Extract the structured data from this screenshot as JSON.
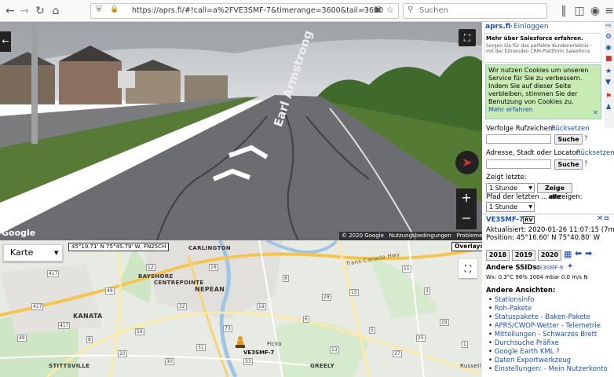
{
  "browser": {
    "url": "https://aprs.fi/#!call=a%2FVE3SMF-7&timerange=3600&tail=3600",
    "search_placeholder": "Suchen"
  },
  "streetview": {
    "street_sign": "Earl Armstrong",
    "google_logo": "Google",
    "copyright": "© 2020 Google",
    "terms": "Nutzungsbedingungen",
    "report": "Probleme melden"
  },
  "map": {
    "type_select": "Karte",
    "coords": "45°19.71' N 75°45.79' W, FN25CH",
    "overlays": "Overlays",
    "station_label": "VE3SMF-7",
    "places": [
      "CARLINGTON",
      "NEPEAN",
      "BAYSHORE",
      "CENTREPOINTE",
      "KANATA",
      "STITTSVILLE",
      "GREELY",
      "Ficko",
      "Russell",
      "Trans-Canada Hwy"
    ],
    "road_numbers": [
      "417",
      "49",
      "12",
      "16",
      "32",
      "19",
      "15",
      "73",
      "59",
      "8",
      "49",
      "417",
      "417",
      "11",
      "3",
      "5",
      "13",
      "19",
      "6",
      "8",
      "27",
      "30",
      "31",
      "33",
      "10",
      "1",
      "25",
      "28"
    ]
  },
  "sidebar": {
    "site": "aprs.fi",
    "login": "Einloggen",
    "ad_title": "Mehr über Salesforce erfahren.",
    "ad_body": "Sorgen Sie für das perfekte Kundenerlebnis – mit der führenden CRM-Plattform Salesforce",
    "cookie_text": "Wir nutzen Cookies um unseren Service für Sie zu verbessern. Indem Sie auf dieser Seite verbleiben, stimmen Sie der Benutzung von Cookies zu.",
    "cookie_more": "Mehr erfahren",
    "track_label": "Verfolge Rufzeichen:",
    "reset1": "Rücksetzen",
    "search_btn": "Suche",
    "help": "?",
    "address_label": "Adresse, Stadt oder Locator:",
    "reset2": "Rücksetzen",
    "show_last": "Zeigt letzte:",
    "hour1": "1 Stunde",
    "show_all": "Zeige alle",
    "path_label": "Pfad der letzten ... anzeigen:",
    "hour2": "1 Stunde",
    "station": "VE3SMF-7",
    "station_badge": "RV",
    "updated": "Aktualisiert: 2020-01-26 11:07:15 (7m)",
    "position": "Position: 45°16.60' N 75°40.80' W",
    "years": [
      "2018",
      "2019",
      "2020"
    ],
    "other_ssids": "Andere SSIDs:",
    "ssid": "VE3SMF-9",
    "wx": "Wx: 0.3°C 96% 1004 mbar 0.0 m/s N",
    "other_views": "Andere Ansichten:",
    "links": [
      "Stationsinfo",
      "Roh-Pakete",
      "Statuspakete - Baken-Pakete",
      "APRS/CWOP-Wetter - Telemetrie",
      "Mitteilungen - Schwarzes Brett",
      "Durchsuche Präfixe",
      "Google Earth KML ?",
      "Daten Exportwerkzeug",
      "Einstellungen: - Mein Nutzerkonto"
    ]
  }
}
